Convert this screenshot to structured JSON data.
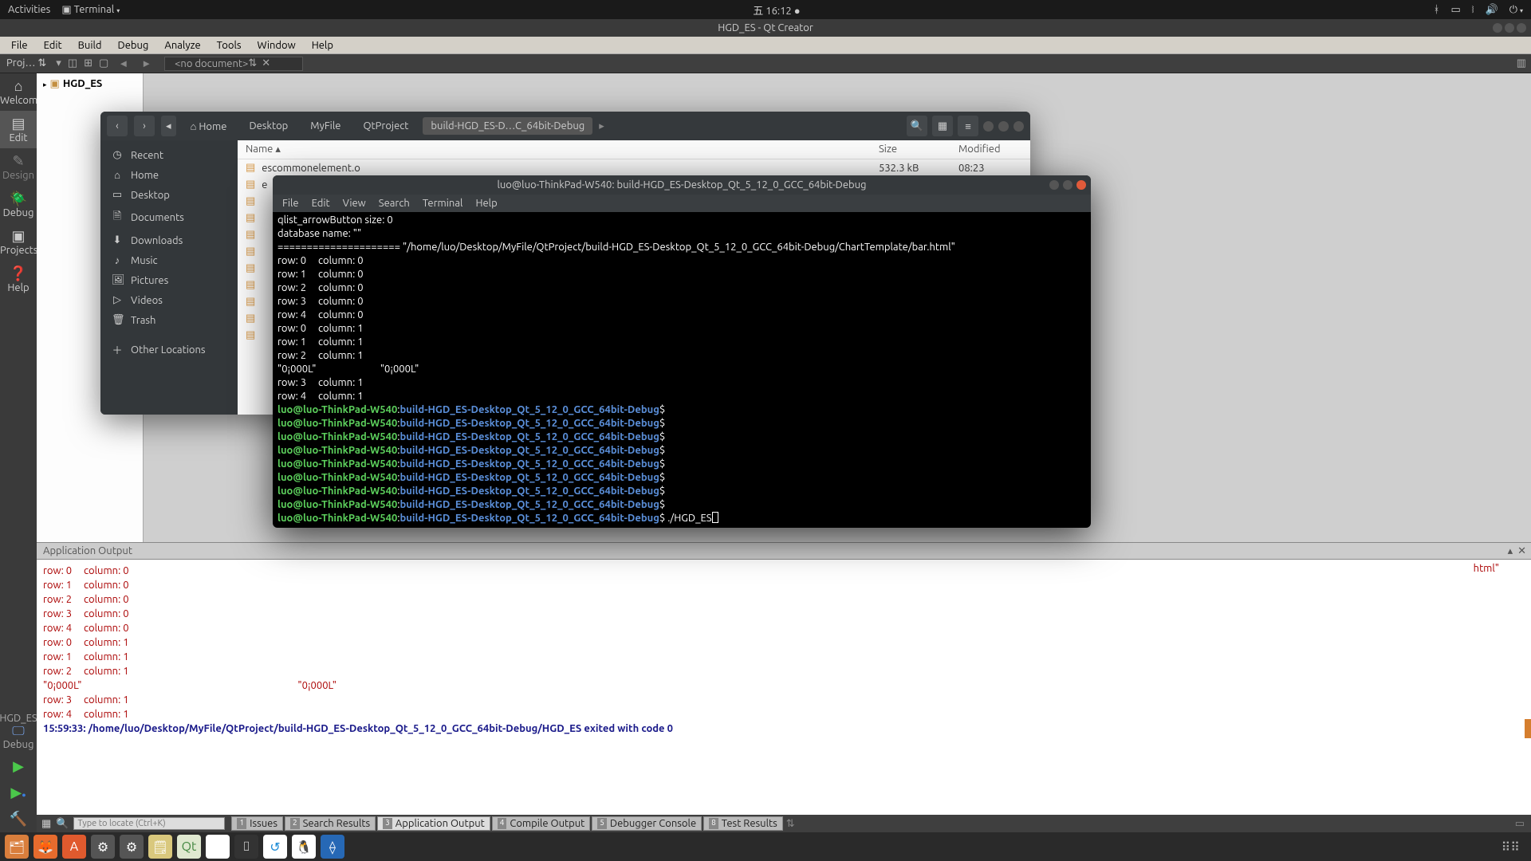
{
  "gnome": {
    "activities": "Activities",
    "app": "Terminal",
    "clock": "五 16:12",
    "tray": [
      "bt",
      "batt",
      "wifi",
      "vol",
      "power"
    ]
  },
  "qtc": {
    "title": "HGD_ES - Qt Creator",
    "menu": [
      "File",
      "Edit",
      "Build",
      "Debug",
      "Analyze",
      "Tools",
      "Window",
      "Help"
    ],
    "toolbar": {
      "project": "Proj…",
      "nodoc": "<no document>"
    },
    "modes": [
      {
        "label": "Welcome",
        "icon": "🔆"
      },
      {
        "label": "Edit",
        "icon": "📝"
      },
      {
        "label": "Design",
        "icon": "✎"
      },
      {
        "label": "Debug",
        "icon": "🪲"
      },
      {
        "label": "Projects",
        "icon": "📁"
      },
      {
        "label": "Help",
        "icon": "❓"
      }
    ],
    "kit": {
      "name": "HGD_ES",
      "build": "Debug"
    },
    "run_icons": [
      "▶",
      "▶",
      "🔨"
    ],
    "project_root": "HGD_ES",
    "output_header": "Application Output",
    "output": {
      "frag_html": "html\"",
      "rows": [
        "row: 0     column: 0",
        "row: 1     column: 0",
        "row: 2     column: 0",
        "row: 3     column: 0",
        "row: 4     column: 0",
        "row: 0     column: 1",
        "row: 1     column: 1",
        "row: 2     column: 1"
      ],
      "garb1": "\"0¡000L\"",
      "garb2": "\"0¡000L\"",
      "rows2": [
        "row: 3     column: 1",
        "row: 4     column: 1"
      ],
      "exit": "15:59:33: /home/luo/Desktop/MyFile/QtProject/build-HGD_ES-Desktop_Qt_5_12_0_GCC_64bit-Debug/HGD_ES exited with code 0"
    },
    "locate_placeholder": "Type to locate (Ctrl+K)",
    "bottom_tabs": [
      {
        "n": "1",
        "t": "Issues"
      },
      {
        "n": "2",
        "t": "Search Results"
      },
      {
        "n": "3",
        "t": "Application Output"
      },
      {
        "n": "4",
        "t": "Compile Output"
      },
      {
        "n": "5",
        "t": "Debugger Console"
      },
      {
        "n": "8",
        "t": "Test Results"
      }
    ]
  },
  "nautilus": {
    "crumbs": [
      "Home",
      "Desktop",
      "MyFile",
      "QtProject",
      "build-HGD_ES-D…C_64bit-Debug"
    ],
    "side": [
      {
        "i": "◷",
        "t": "Recent"
      },
      {
        "i": "⌂",
        "t": "Home"
      },
      {
        "i": "▭",
        "t": "Desktop"
      },
      {
        "i": "🗎",
        "t": "Documents"
      },
      {
        "i": "⬇",
        "t": "Downloads"
      },
      {
        "i": "♪",
        "t": "Music"
      },
      {
        "i": "🖼",
        "t": "Pictures"
      },
      {
        "i": "▷",
        "t": "Videos"
      },
      {
        "i": "🗑",
        "t": "Trash"
      },
      {
        "i": "＋",
        "t": "Other Locations"
      }
    ],
    "cols": {
      "name": "Name",
      "size": "Size",
      "mod": "Modified"
    },
    "rows": [
      {
        "name": "escommonelement.o",
        "size": "532.3 kB",
        "mod": "08:23"
      }
    ]
  },
  "term": {
    "title": "luo@luo-ThinkPad-W540: build-HGD_ES-Desktop_Qt_5_12_0_GCC_64bit-Debug",
    "menu": [
      "File",
      "Edit",
      "View",
      "Search",
      "Terminal",
      "Help"
    ],
    "l1": "qlist_arrowButton size: 0",
    "l2": "database name: \"\"",
    "l3": "===================== \"/home/luo/Desktop/MyFile/QtProject/build-HGD_ES-Desktop_Qt_5_12_0_GCC_64bit-Debug/ChartTemplate/bar.html\"",
    "rows": [
      "row: 0     column: 0",
      "row: 1     column: 0",
      "row: 2     column: 0",
      "row: 3     column: 0",
      "row: 4     column: 0",
      "row: 0     column: 1",
      "row: 1     column: 1",
      "row: 2     column: 1"
    ],
    "garb": "\"0¡000L\"                           \"0¡000L\"",
    "rows2": [
      "row: 3     column: 1",
      "row: 4     column: 1"
    ],
    "prompt_user": "luo@luo-ThinkPad-W540",
    "prompt_path": "build-HGD_ES-Desktop_Qt_5_12_0_GCC_64bit-Debug",
    "cmd": "./HGD_ES"
  },
  "dock": [
    "files",
    "firefox",
    "ubuntu",
    "gear1",
    "gear2",
    "notes",
    "qt",
    "chrome",
    "term",
    "teamv",
    "qq",
    "vscode"
  ]
}
